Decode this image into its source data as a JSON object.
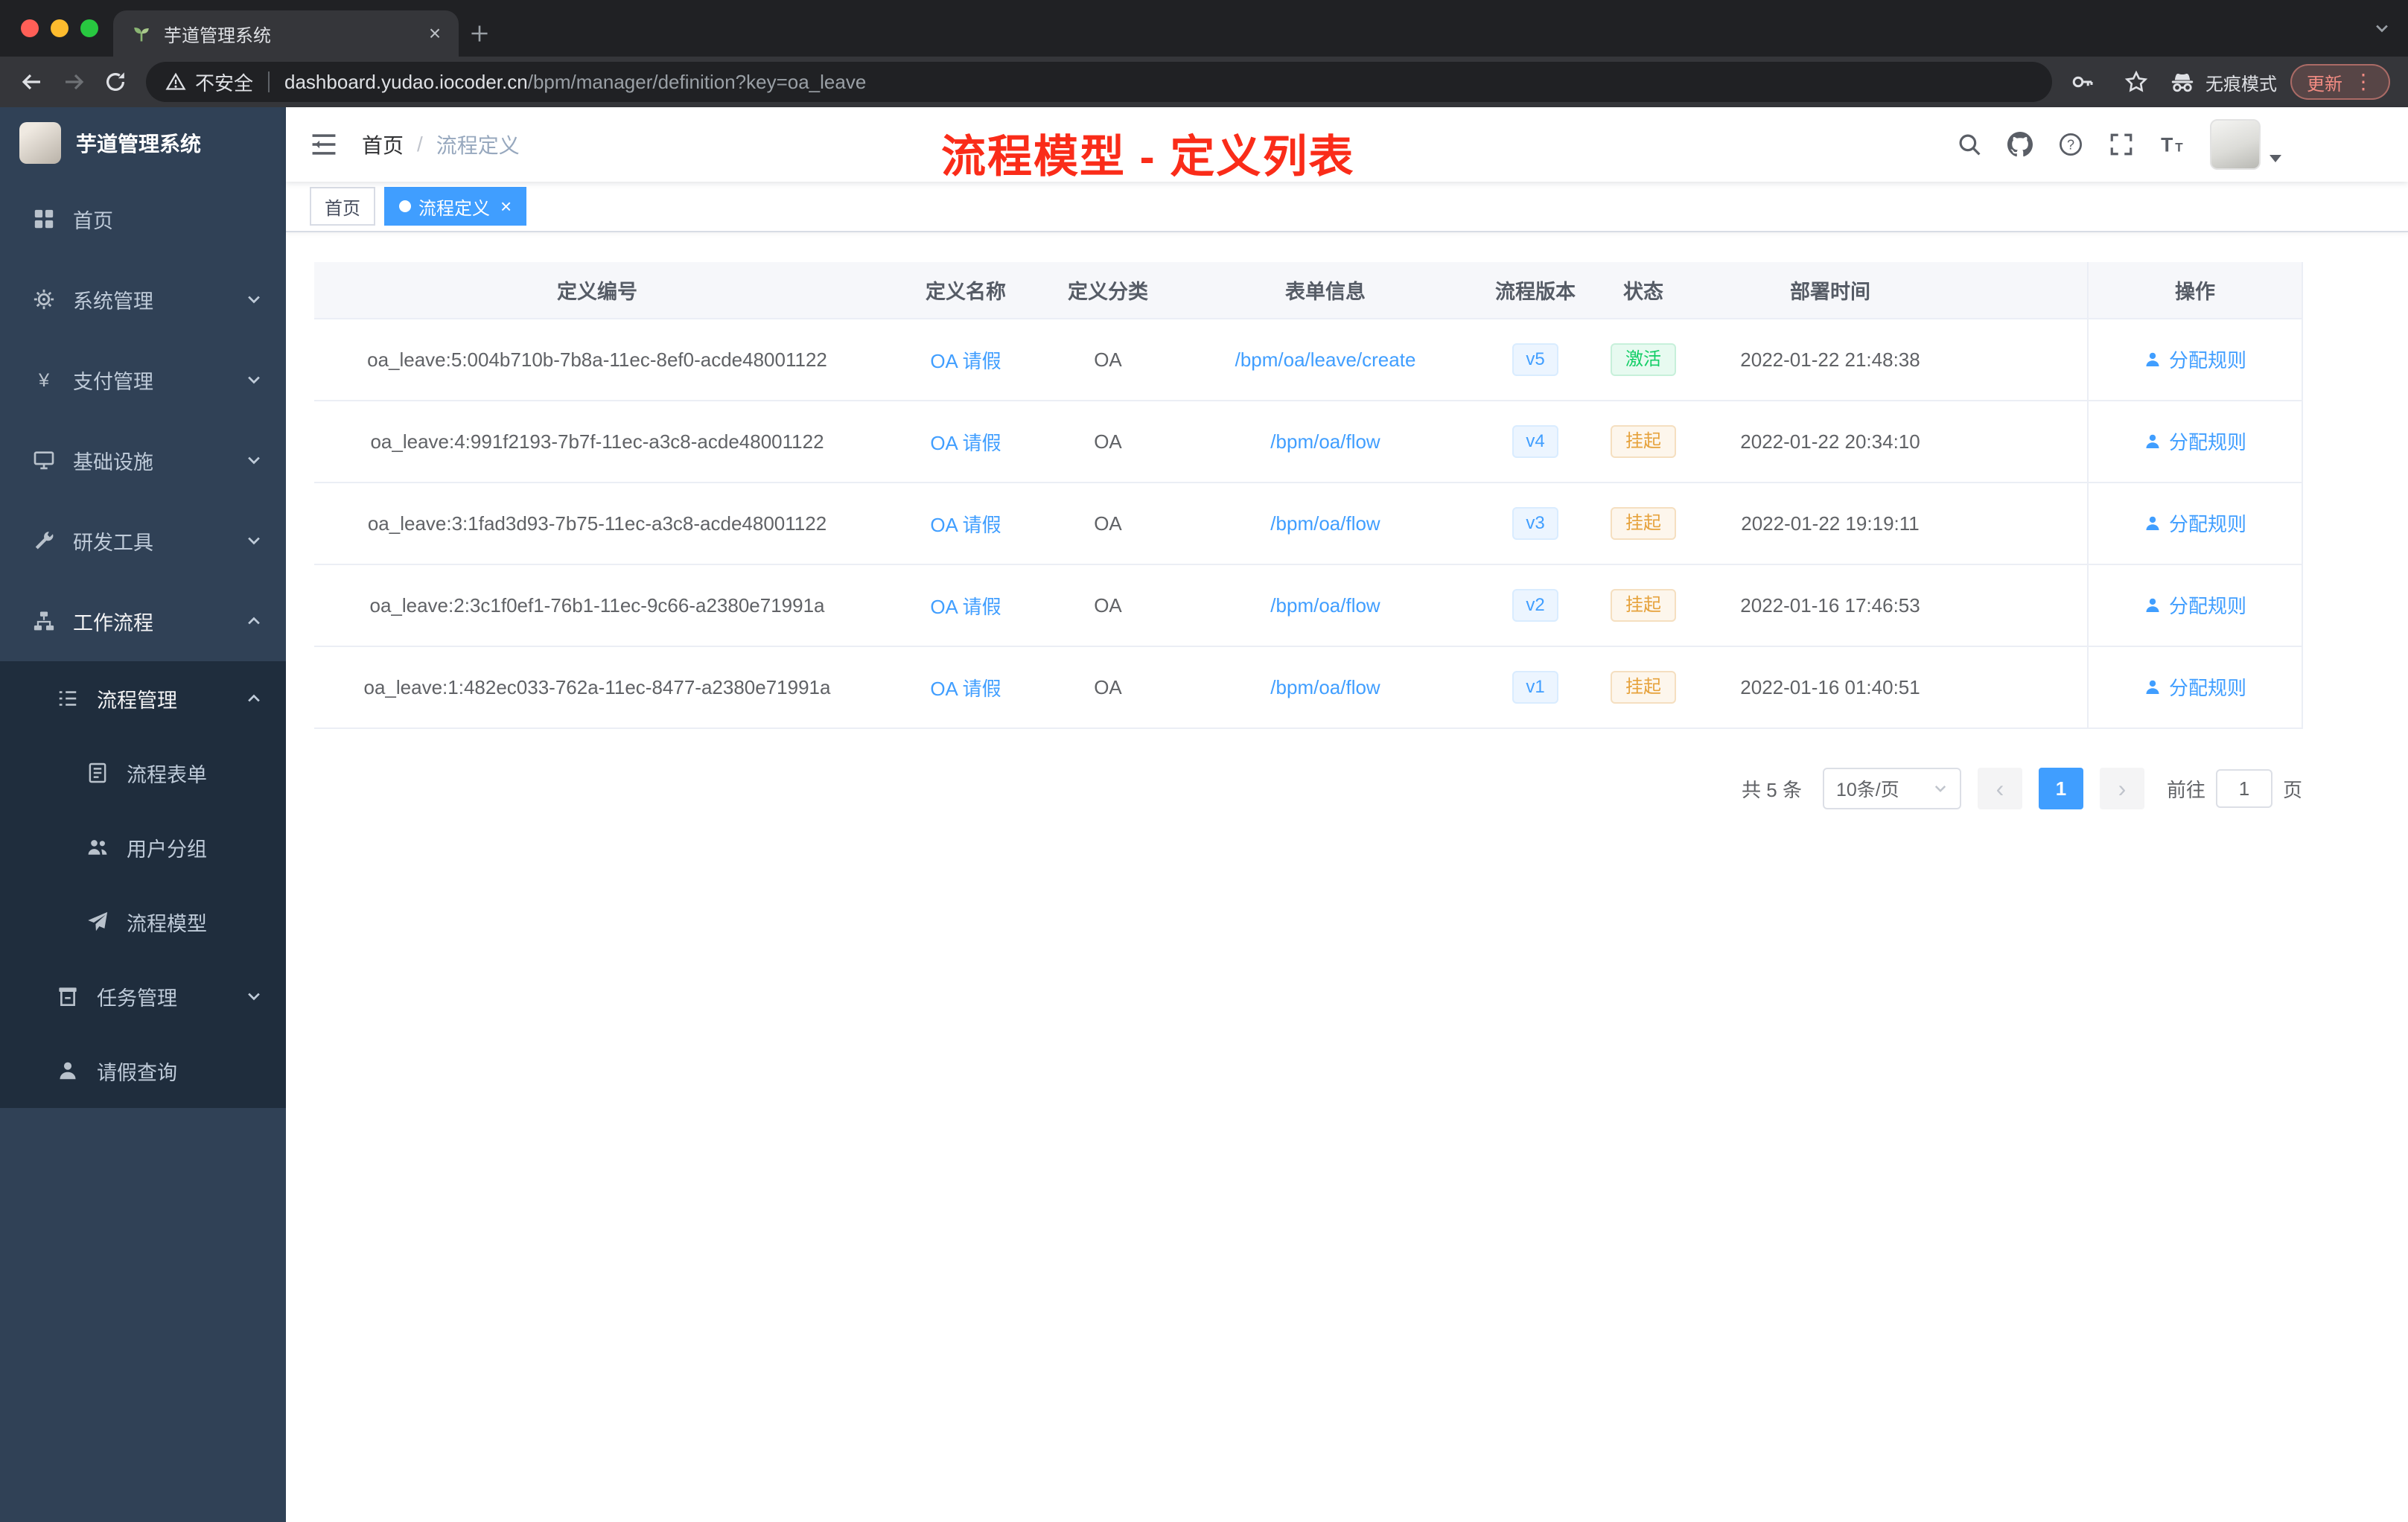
{
  "colors": {
    "accent_blue": "#409eff",
    "status_active_green": "#13ce66",
    "status_suspended_orange": "#e6a23c",
    "annotation_red": "#fa2c19",
    "sidebar_bg": "#304156",
    "sidebar_sub_bg": "#1f2d3d"
  },
  "browser": {
    "tab_title": "芋道管理系统",
    "security_label": "不安全",
    "url_domain": "dashboard.yudao.iocoder.cn",
    "url_path": "/bpm/manager/definition?key=oa_leave",
    "incognito_label": "无痕模式",
    "update_label": "更新"
  },
  "sidebar": {
    "brand": "芋道管理系统",
    "menu": [
      {
        "label": "首页",
        "icon": "dashboard-icon",
        "level": 1,
        "arrow": null,
        "sub": false,
        "open": false
      },
      {
        "label": "系统管理",
        "icon": "gear-icon",
        "level": 1,
        "arrow": "down",
        "sub": false,
        "open": false
      },
      {
        "label": "支付管理",
        "icon": "yen-icon",
        "level": 1,
        "arrow": "down",
        "sub": false,
        "open": false
      },
      {
        "label": "基础设施",
        "icon": "infra-icon",
        "level": 1,
        "arrow": "down",
        "sub": false,
        "open": false
      },
      {
        "label": "研发工具",
        "icon": "tool-icon",
        "level": 1,
        "arrow": "down",
        "sub": false,
        "open": false
      },
      {
        "label": "工作流程",
        "icon": "workflow-icon",
        "level": 1,
        "arrow": "up",
        "sub": false,
        "open": true
      },
      {
        "label": "流程管理",
        "icon": "process-icon",
        "level": 2,
        "arrow": "up",
        "sub": true,
        "open": true
      },
      {
        "label": "流程表单",
        "icon": "form-icon",
        "level": 3,
        "arrow": null,
        "sub": true,
        "open": false
      },
      {
        "label": "用户分组",
        "icon": "users-icon",
        "level": 3,
        "arrow": null,
        "sub": true,
        "open": false
      },
      {
        "label": "流程模型",
        "icon": "model-icon",
        "level": 3,
        "arrow": null,
        "sub": true,
        "open": false
      },
      {
        "label": "任务管理",
        "icon": "task-icon",
        "level": 2,
        "arrow": "down",
        "sub": true,
        "open": false
      },
      {
        "label": "请假查询",
        "icon": "person-icon",
        "level": 2,
        "arrow": null,
        "sub": true,
        "open": false
      }
    ]
  },
  "navbar": {
    "breadcrumb": {
      "home": "首页",
      "separator": "/",
      "current": "流程定义"
    },
    "annotation": "流程模型 - 定义列表"
  },
  "tags": {
    "home": "首页",
    "active": "流程定义"
  },
  "table": {
    "headers": [
      "定义编号",
      "定义名称",
      "定义分类",
      "表单信息",
      "流程版本",
      "状态",
      "部署时间",
      "操作"
    ],
    "rows": [
      {
        "id": "oa_leave:5:004b710b-7b8a-11ec-8ef0-acde48001122",
        "name": "OA 请假",
        "category": "OA",
        "form": "/bpm/oa/leave/create",
        "version": "v5",
        "status": "激活",
        "status_type": "active",
        "time": "2022-01-22 21:48:38",
        "action": "分配规则"
      },
      {
        "id": "oa_leave:4:991f2193-7b7f-11ec-a3c8-acde48001122",
        "name": "OA 请假",
        "category": "OA",
        "form": "/bpm/oa/flow",
        "version": "v4",
        "status": "挂起",
        "status_type": "suspended",
        "time": "2022-01-22 20:34:10",
        "action": "分配规则"
      },
      {
        "id": "oa_leave:3:1fad3d93-7b75-11ec-a3c8-acde48001122",
        "name": "OA 请假",
        "category": "OA",
        "form": "/bpm/oa/flow",
        "version": "v3",
        "status": "挂起",
        "status_type": "suspended",
        "time": "2022-01-22 19:19:11",
        "action": "分配规则"
      },
      {
        "id": "oa_leave:2:3c1f0ef1-76b1-11ec-9c66-a2380e71991a",
        "name": "OA 请假",
        "category": "OA",
        "form": "/bpm/oa/flow",
        "version": "v2",
        "status": "挂起",
        "status_type": "suspended",
        "time": "2022-01-16 17:46:53",
        "action": "分配规则"
      },
      {
        "id": "oa_leave:1:482ec033-762a-11ec-8477-a2380e71991a",
        "name": "OA 请假",
        "category": "OA",
        "form": "/bpm/oa/flow",
        "version": "v1",
        "status": "挂起",
        "status_type": "suspended",
        "time": "2022-01-16 01:40:51",
        "action": "分配规则"
      }
    ]
  },
  "pagination": {
    "total": "共 5 条",
    "page_size": "10条/页",
    "page": "1",
    "goto_label": "前往",
    "page_unit": "页",
    "goto_value": "1"
  }
}
